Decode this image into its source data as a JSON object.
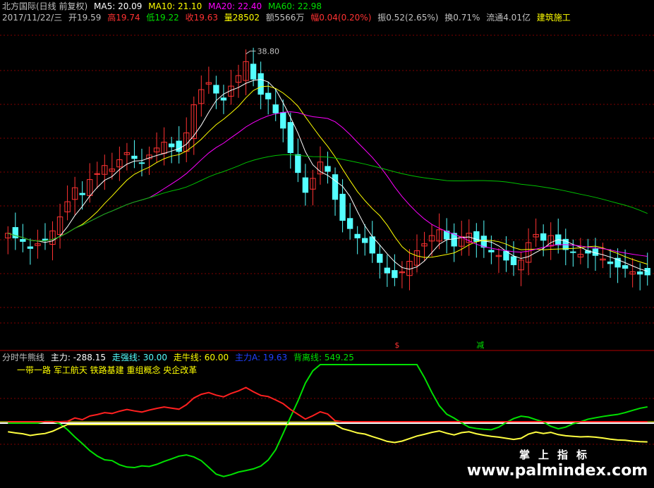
{
  "header": {
    "title": "北方国际(日线 前复权)",
    "ma5": "MA5: 20.09",
    "ma10": "MA10: 21.10",
    "ma20": "MA20: 22.40",
    "ma60": "MA60: 22.98",
    "date": "2017/11/22/三",
    "open": "开19.59",
    "high": "高19.74",
    "low": "低19.22",
    "close": "收19.63",
    "volume": "量28502",
    "amount": "额5566万",
    "change": "幅0.04(0.20%)",
    "amplitude": "振0.52(2.65%)",
    "turnover": "换0.71%",
    "float": "流通4.01亿",
    "sector": "建筑施工"
  },
  "indicator": {
    "name": "分时牛熊线",
    "zhuli": "主力: -288.15",
    "zouqiang": "走强线: 30.00",
    "zouniu": "走牛线: 60.00",
    "zhulia": "主力A: 19.63",
    "beili": "背离线: 549.25",
    "concepts": "一带一路 军工航天 铁路基建 重组概念 央企改革"
  },
  "signals": {
    "s": "$",
    "jian": "减"
  },
  "peak_label": "38.80",
  "watermark": {
    "line1": "掌上指标",
    "line2": "www.palmindex.com"
  },
  "colors": {
    "ma5": "#ffffff",
    "ma10": "#ffff00",
    "ma20": "#ff00ff",
    "ma60": "#00c000",
    "up": "#ff3232",
    "down": "#54ffff",
    "label": "#c0c0c0",
    "grid": "#800000",
    "sector": "#ffff00"
  },
  "chart_data": [
    {
      "type": "candlestick",
      "title": "北方国际(日线 前复权)",
      "xlabel": "",
      "ylabel": "",
      "annotation_max": 38.8,
      "ylim": [
        16,
        41
      ],
      "series": [
        {
          "name": "MA5",
          "last": 20.09
        },
        {
          "name": "MA10",
          "last": 21.1
        },
        {
          "name": "MA20",
          "last": 22.4
        },
        {
          "name": "MA60",
          "last": 22.98
        }
      ],
      "close_approx": [
        23.2,
        22.8,
        22.5,
        21.9,
        22.3,
        22.6,
        23.4,
        24.6,
        25.9,
        27.1,
        26.5,
        27.8,
        28.3,
        29.0,
        28.7,
        29.5,
        30.1,
        29.6,
        29.2,
        29.9,
        30.5,
        31.0,
        30.6,
        30.2,
        31.8,
        34.2,
        35.5,
        36.1,
        35.2,
        34.6,
        35.8,
        36.7,
        37.9,
        36.4,
        35.1,
        34.7,
        33.5,
        32.2,
        30.1,
        28.4,
        26.7,
        27.9,
        29.3,
        28.5,
        26.1,
        24.3,
        23.6,
        22.8,
        22.4,
        21.5,
        20.7,
        19.8,
        19.4,
        19.9,
        20.8,
        21.7,
        22.3,
        23.0,
        23.5,
        22.7,
        22.1,
        22.9,
        23.2,
        22.5,
        22.0,
        21.6,
        21.3,
        20.9,
        20.5,
        20.9,
        22.4,
        23.1,
        22.6,
        23.0,
        22.2,
        21.8,
        21.6,
        21.4,
        21.5,
        21.3,
        21.0,
        20.6,
        20.3,
        20.2,
        19.9,
        19.7,
        19.63
      ]
    },
    {
      "type": "line",
      "title": "分时牛熊线",
      "series": [
        {
          "name": "主力",
          "last": -288.15
        },
        {
          "name": "走强线",
          "last": 30.0
        },
        {
          "name": "走牛线",
          "last": 60.0
        },
        {
          "name": "主力A",
          "last": 19.63
        },
        {
          "name": "背离线",
          "last": 549.25
        }
      ]
    }
  ]
}
